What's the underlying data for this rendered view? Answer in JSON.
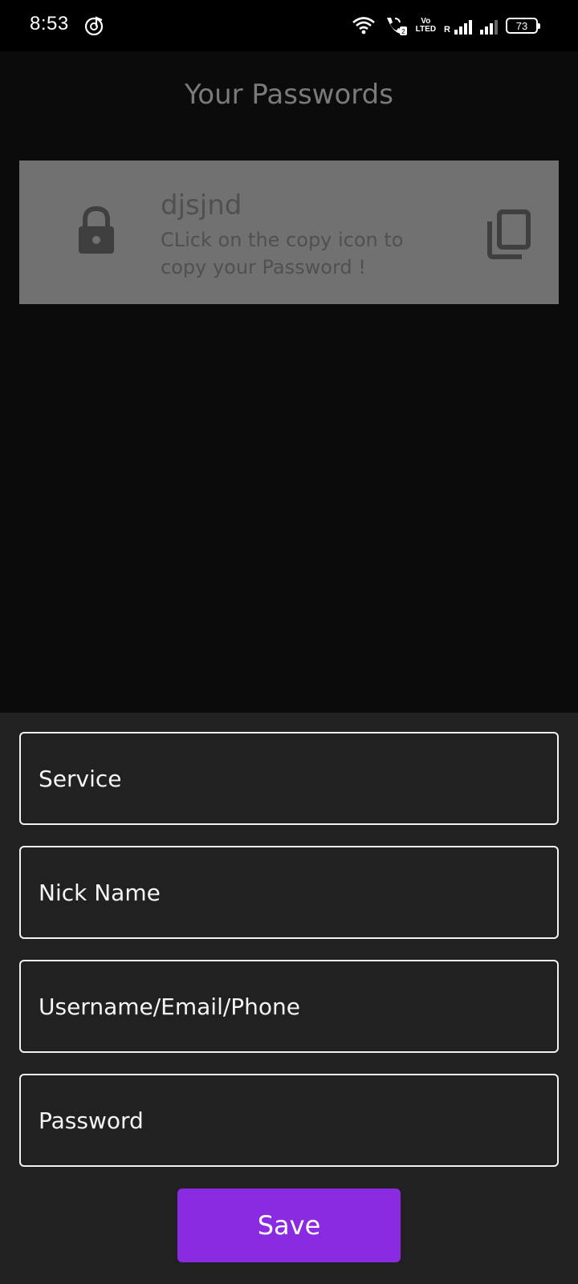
{
  "status_bar": {
    "time": "8:53",
    "battery": "73",
    "volte_top": "Vo",
    "volte_bottom": "LTED",
    "roaming": "R",
    "icons": [
      "music-icon",
      "wifi-icon",
      "wifi-calling-icon",
      "volte-icon",
      "signal-icon",
      "signal-icon",
      "battery-icon"
    ]
  },
  "header": {
    "title": "Your Passwords"
  },
  "passwords": [
    {
      "name": "djsjnd",
      "hint": "CLick on the copy icon to copy your Password !",
      "icon": "lock-icon",
      "action_icon": "copy-icon"
    }
  ],
  "form": {
    "service_placeholder": "Service",
    "nickname_placeholder": "Nick Name",
    "username_placeholder": "Username/Email/Phone",
    "password_placeholder": "Password",
    "save_label": "Save"
  },
  "colors": {
    "background": "#0b0b0b",
    "card": "#717171",
    "sheet": "#212121",
    "accent": "#8a2be2"
  }
}
